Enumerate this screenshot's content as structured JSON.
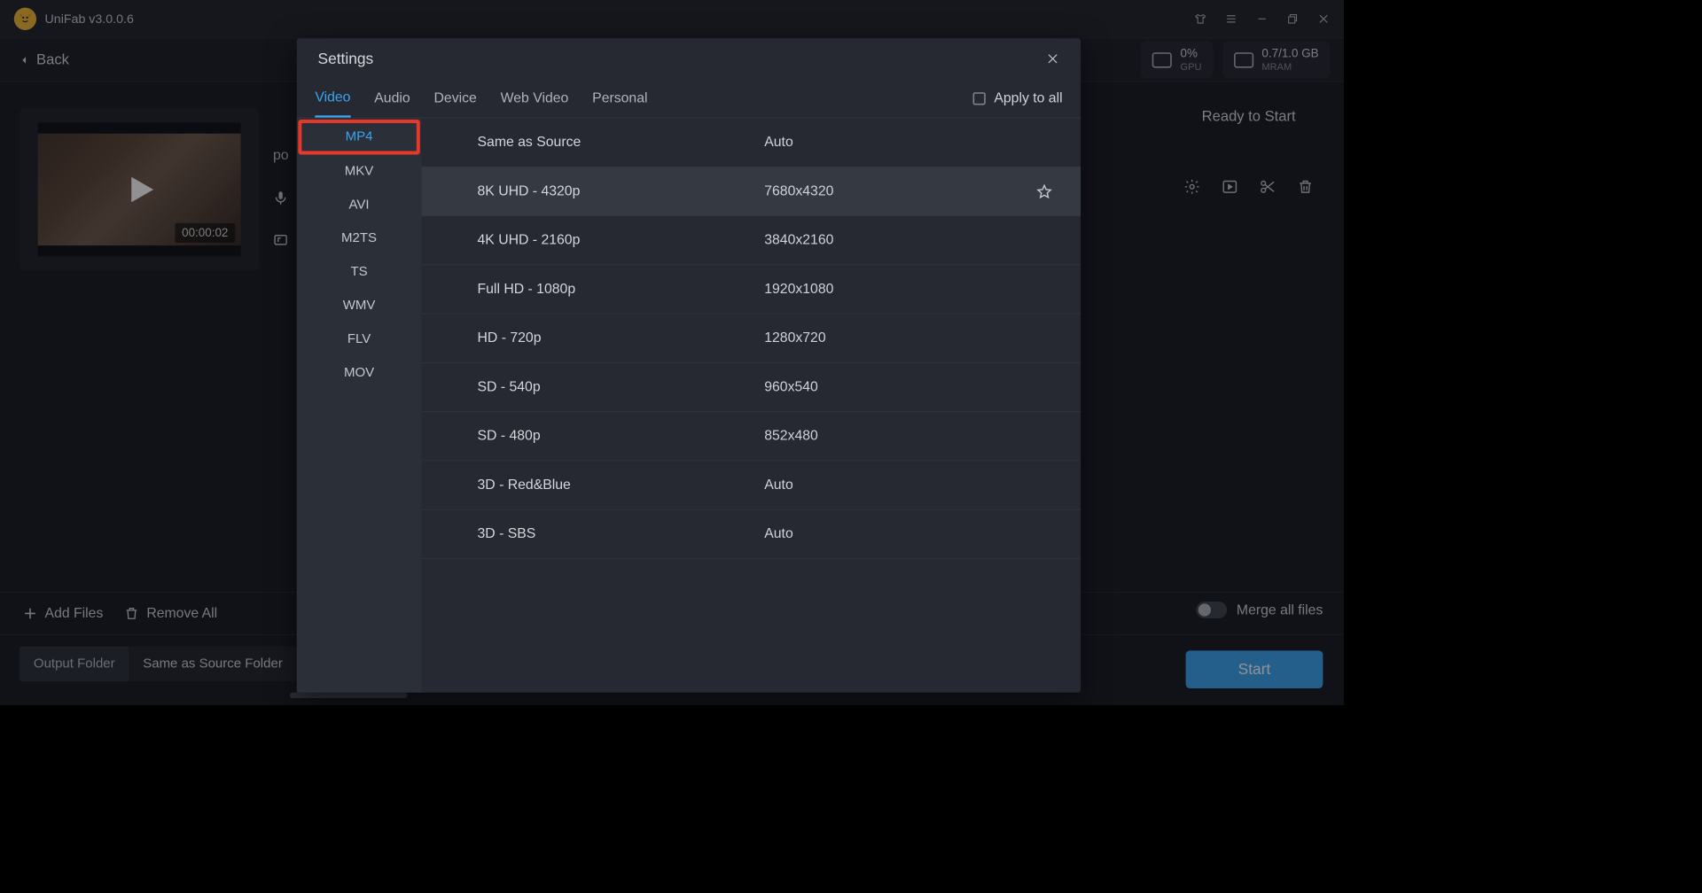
{
  "app": {
    "title": "UniFab v3.0.0.6"
  },
  "subbar": {
    "back": "Back",
    "gpu_val": "0%",
    "gpu_lbl": "GPU",
    "ram_val": "0.7/1.0 GB",
    "ram_lbl": "MRAM"
  },
  "thumb": {
    "timecode": "00:00:02"
  },
  "side": {
    "port_prefix": "po"
  },
  "bottom": {
    "add": "Add Files",
    "remove": "Remove All"
  },
  "output": {
    "label": "Output Folder",
    "value": "Same as Source Folder"
  },
  "right": {
    "ready": "Ready to Start",
    "merge": "Merge all files",
    "start": "Start"
  },
  "settings": {
    "title": "Settings",
    "apply": "Apply to all",
    "tabs": [
      "Video",
      "Audio",
      "Device",
      "Web Video",
      "Personal"
    ],
    "active_tab": 0,
    "formats": [
      "MP4",
      "MKV",
      "AVI",
      "M2TS",
      "TS",
      "WMV",
      "FLV",
      "MOV"
    ],
    "active_format": 0,
    "resolutions": [
      {
        "name": "Same as Source",
        "dim": "Auto"
      },
      {
        "name": "8K UHD - 4320p",
        "dim": "7680x4320",
        "selected": true,
        "star": true
      },
      {
        "name": "4K UHD - 2160p",
        "dim": "3840x2160"
      },
      {
        "name": "Full HD - 1080p",
        "dim": "1920x1080"
      },
      {
        "name": "HD - 720p",
        "dim": "1280x720"
      },
      {
        "name": "SD - 540p",
        "dim": "960x540"
      },
      {
        "name": "SD - 480p",
        "dim": "852x480"
      },
      {
        "name": "3D - Red&Blue",
        "dim": "Auto"
      },
      {
        "name": "3D - SBS",
        "dim": "Auto"
      }
    ]
  }
}
